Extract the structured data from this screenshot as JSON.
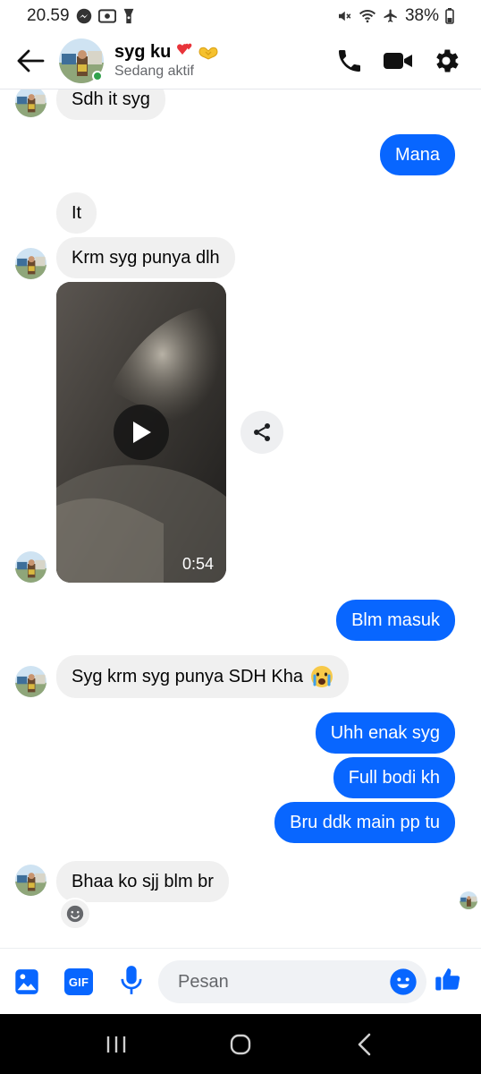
{
  "status_bar": {
    "time": "20.59",
    "battery": "38%"
  },
  "header": {
    "contact_name": "syg ku",
    "contact_status": "Sedang aktif"
  },
  "messages": {
    "m1": "Sdh it syg",
    "m2": "Mana",
    "m3": "It",
    "m4": "Krm syg punya dlh",
    "video_duration": "0:54",
    "m5": "Blm masuk",
    "m6": "Syg krm syg punya SDH Kha",
    "m7": "Uhh enak syg",
    "m8": "Full bodi kh",
    "m9": "Bru ddk main pp tu",
    "m10": "Bhaa ko sjj blm br"
  },
  "composer": {
    "gif_label": "GIF",
    "placeholder": "Pesan"
  },
  "colors": {
    "accent": "#0866ff",
    "incoming_bubble": "#f0f0f0",
    "online": "#31a24c"
  },
  "icons": [
    "back-arrow-icon",
    "phone-icon",
    "video-call-icon",
    "gear-icon",
    "play-icon",
    "share-icon",
    "smile-icon",
    "gallery-icon",
    "mic-icon",
    "like-icon",
    "messenger-icon",
    "screen-record-icon",
    "flashlight-icon",
    "mute-icon",
    "wifi-icon",
    "airplane-icon",
    "battery-icon"
  ]
}
